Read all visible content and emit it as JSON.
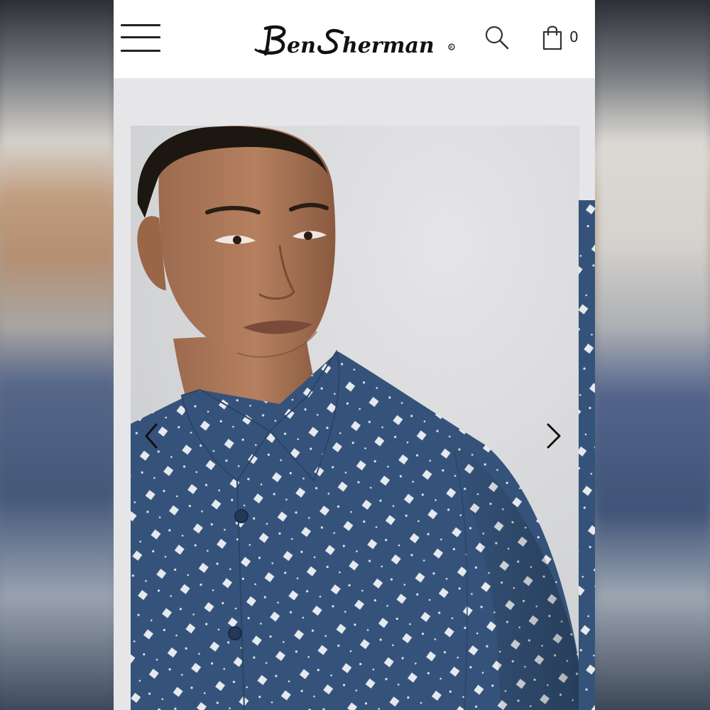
{
  "header": {
    "menu_icon": "hamburger-menu-icon",
    "brand": "Ben Sherman",
    "registered_mark": "®",
    "search_icon": "search-icon",
    "bag_icon": "shopping-bag-icon",
    "bag_count": "0"
  },
  "gallery": {
    "prev_icon": "chevron-left-icon",
    "next_icon": "chevron-right-icon",
    "product_colors": {
      "shirt": "#35537a",
      "pattern": "#e6e9ee",
      "background": "#d9d9db"
    }
  }
}
